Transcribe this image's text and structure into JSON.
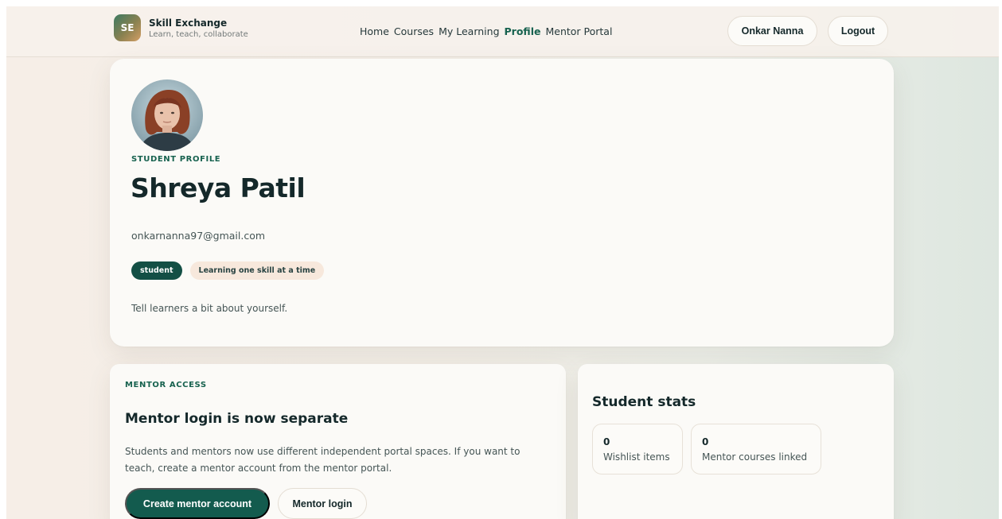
{
  "header": {
    "logo_text": "SE",
    "brand_title": "Skill Exchange",
    "brand_subtitle": "Learn, teach, collaborate",
    "nav": [
      {
        "label": "Home",
        "active": false
      },
      {
        "label": "Courses",
        "active": false
      },
      {
        "label": "My Learning",
        "active": false
      },
      {
        "label": "Profile",
        "active": true
      },
      {
        "label": "Mentor Portal",
        "active": false
      }
    ],
    "user_name": "Onkar Nanna",
    "logout_label": "Logout"
  },
  "profile": {
    "eyebrow": "STUDENT PROFILE",
    "name": "Shreya Patil",
    "email": "onkarnanna97@gmail.com",
    "role_badge": "student",
    "tagline_badge": "Learning one skill at a time",
    "bio": "Tell learners a bit about yourself."
  },
  "mentor_access": {
    "eyebrow": "MENTOR ACCESS",
    "title": "Mentor login is now separate",
    "description": "Students and mentors now use different independent portal spaces. If you want to teach, create a mentor account from the mentor portal.",
    "create_button": "Create mentor account",
    "login_button": "Mentor login"
  },
  "stats": {
    "title": "Student stats",
    "items": [
      {
        "value": "0",
        "label": "Wishlist items"
      },
      {
        "value": "0",
        "label": "Mentor courses linked"
      }
    ]
  },
  "colors": {
    "accent": "#17624f",
    "primary_button": "#135b4e",
    "badge_dark": "#134f45",
    "badge_light": "#f7e8dc"
  }
}
